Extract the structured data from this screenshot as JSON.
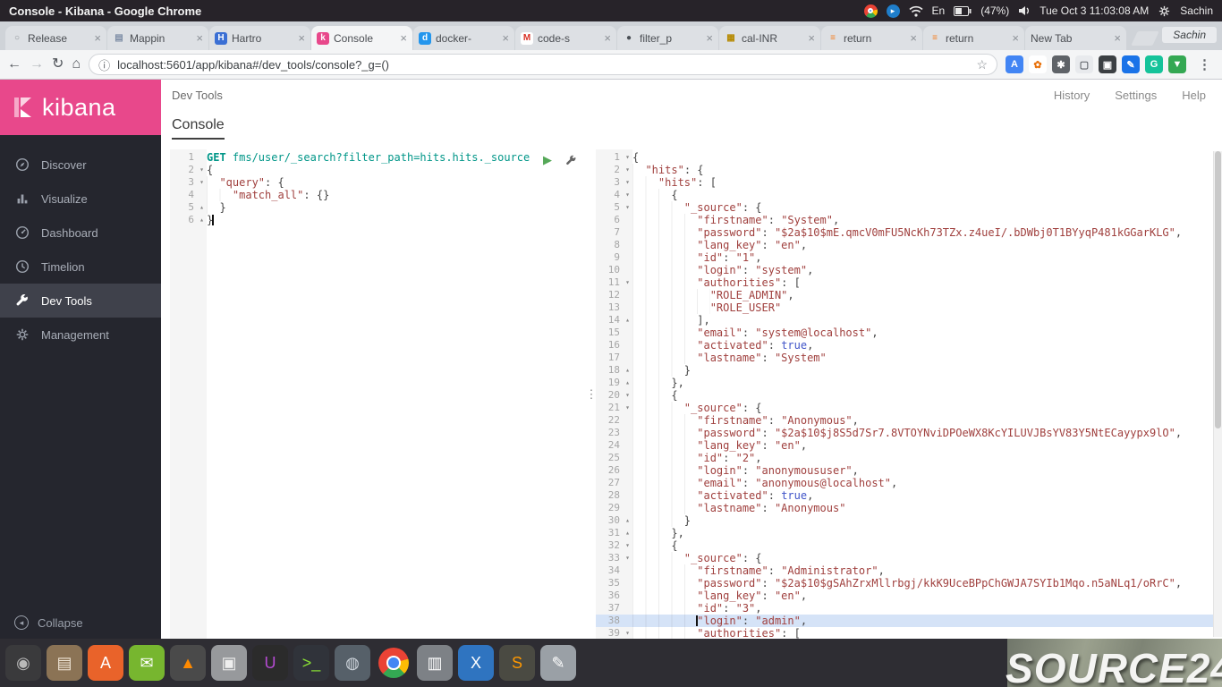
{
  "system_bar": {
    "window_title": "Console - Kibana - Google Chrome",
    "tray": [
      {
        "kind": "icon",
        "name": "chrome-icon"
      },
      {
        "kind": "icon",
        "name": "software-updater-icon"
      },
      {
        "kind": "icon",
        "name": "wifi-icon"
      },
      {
        "kind": "text",
        "name": "keyboard-indicator",
        "text": "En"
      },
      {
        "kind": "icon",
        "name": "battery-icon"
      },
      {
        "kind": "text",
        "name": "battery-percentage",
        "text": "(47%)"
      },
      {
        "kind": "icon",
        "name": "volume-icon"
      },
      {
        "kind": "text",
        "name": "clock",
        "text": "Tue Oct 3 11:03:08 AM"
      },
      {
        "kind": "icon",
        "name": "session-gear-icon"
      },
      {
        "kind": "text",
        "name": "session-user",
        "text": "Sachin"
      }
    ]
  },
  "browser": {
    "profile": "Sachin",
    "url": "localhost:5601/app/kibana#/dev_tools/console?_g=()",
    "tabs": [
      {
        "label": "Release",
        "icon": "release-circle-icon",
        "active": false
      },
      {
        "label": "Mappin",
        "icon": "list-icon",
        "active": false
      },
      {
        "label": "Hartro",
        "icon": "h-doc-icon",
        "active": false
      },
      {
        "label": "Console",
        "icon": "kibana-icon",
        "active": true
      },
      {
        "label": "docker-",
        "icon": "docker-icon",
        "active": false
      },
      {
        "label": "code-s",
        "icon": "gmail-icon",
        "active": false
      },
      {
        "label": "filter_p",
        "icon": "page-circle-icon",
        "active": false
      },
      {
        "label": "cal-INR",
        "icon": "calculator-icon",
        "active": false
      },
      {
        "label": "return",
        "icon": "stackoverflow-icon",
        "active": false
      },
      {
        "label": "return",
        "icon": "stackoverflow-icon",
        "active": false
      },
      {
        "label": "New Tab",
        "icon": "",
        "active": false
      }
    ],
    "extensions": [
      {
        "name": "translate-icon",
        "glyph": "A",
        "bg": "#4285f4",
        "fg": "#ffffff"
      },
      {
        "name": "pinwheel-icon",
        "glyph": "✿",
        "bg": "#ffffff",
        "fg": "#e8710a"
      },
      {
        "name": "gear-extension-icon",
        "glyph": "✱",
        "bg": "#5f6368",
        "fg": "#ffffff"
      },
      {
        "name": "window-extension-icon",
        "glyph": "▢",
        "bg": "#e8eaed",
        "fg": "#5f6368"
      },
      {
        "name": "tag-extension-icon",
        "glyph": "▣",
        "bg": "#3c4043",
        "fg": "#ffffff"
      },
      {
        "name": "pen-extension-icon",
        "glyph": "✎",
        "bg": "#1a73e8",
        "fg": "#ffffff"
      },
      {
        "name": "grammarly-icon",
        "glyph": "G",
        "bg": "#15c39a",
        "fg": "#ffffff"
      },
      {
        "name": "download-extension-icon",
        "glyph": "▼",
        "bg": "#34a853",
        "fg": "#ffffff"
      }
    ]
  },
  "kibana": {
    "logo_text": "kibana",
    "breadcrumb": "Dev Tools",
    "top_links": [
      "History",
      "Settings",
      "Help"
    ],
    "console_tab": "Console",
    "collapse_label": "Collapse",
    "nav": [
      {
        "label": "Discover",
        "icon": "discover-icon",
        "active": false
      },
      {
        "label": "Visualize",
        "icon": "visualize-icon",
        "active": false
      },
      {
        "label": "Dashboard",
        "icon": "dashboard-icon",
        "active": false
      },
      {
        "label": "Timelion",
        "icon": "timelion-icon",
        "active": false
      },
      {
        "label": "Dev Tools",
        "icon": "wrench-icon",
        "active": true
      },
      {
        "label": "Management",
        "icon": "gear-icon",
        "active": false
      }
    ]
  },
  "colors": {
    "kibana_pink": "#e8488b",
    "method_teal": "#009688",
    "string_red": "#a0403e",
    "boolean_blue": "#4054c8",
    "play_green": "#55a858",
    "active_line": "#d5e3f7"
  },
  "request_editor": {
    "lines": [
      {
        "n": 1,
        "f": "",
        "seg": [
          [
            "m",
            "GET "
          ],
          [
            "u",
            "fms/user/_search?filter_path=hits.hits._source"
          ]
        ]
      },
      {
        "n": 2,
        "f": "d",
        "seg": [
          [
            "p",
            "{"
          ]
        ]
      },
      {
        "n": 3,
        "f": "d",
        "seg": [
          [
            "ws",
            "  "
          ],
          [
            "k",
            "\"query\""
          ],
          [
            "p",
            ": {"
          ]
        ]
      },
      {
        "n": 4,
        "f": "",
        "seg": [
          [
            "ws",
            "    "
          ],
          [
            "k",
            "\"match_all\""
          ],
          [
            "p",
            ": {}"
          ]
        ]
      },
      {
        "n": 5,
        "f": "u",
        "seg": [
          [
            "ws",
            "  "
          ],
          [
            "p",
            "}"
          ]
        ]
      },
      {
        "n": 6,
        "f": "u",
        "seg": [
          [
            "p",
            "}"
          ],
          [
            "caret",
            ""
          ]
        ]
      }
    ]
  },
  "response_editor": {
    "lines": [
      {
        "n": 1,
        "f": "d",
        "seg": [
          [
            "p",
            "{"
          ]
        ]
      },
      {
        "n": 2,
        "f": "d",
        "seg": [
          [
            "ws",
            "  "
          ],
          [
            "k",
            "\"hits\""
          ],
          [
            "p",
            ": {"
          ]
        ]
      },
      {
        "n": 3,
        "f": "d",
        "seg": [
          [
            "ws",
            "    "
          ],
          [
            "k",
            "\"hits\""
          ],
          [
            "p",
            ": ["
          ]
        ]
      },
      {
        "n": 4,
        "f": "d",
        "seg": [
          [
            "ws",
            "      "
          ],
          [
            "p",
            "{"
          ]
        ]
      },
      {
        "n": 5,
        "f": "d",
        "seg": [
          [
            "ws",
            "        "
          ],
          [
            "k",
            "\"_source\""
          ],
          [
            "p",
            ": {"
          ]
        ]
      },
      {
        "n": 6,
        "f": "",
        "seg": [
          [
            "ws",
            "          "
          ],
          [
            "k",
            "\"firstname\""
          ],
          [
            "p",
            ": "
          ],
          [
            "s",
            "\"System\""
          ],
          [
            "p",
            ","
          ]
        ]
      },
      {
        "n": 7,
        "f": "",
        "seg": [
          [
            "ws",
            "          "
          ],
          [
            "k",
            "\"password\""
          ],
          [
            "p",
            ": "
          ],
          [
            "s",
            "\"$2a$10$mE.qmcV0mFU5NcKh73TZx.z4ueI/.bDWbj0T1BYyqP481kGGarKLG\""
          ],
          [
            "p",
            ","
          ]
        ]
      },
      {
        "n": 8,
        "f": "",
        "seg": [
          [
            "ws",
            "          "
          ],
          [
            "k",
            "\"lang_key\""
          ],
          [
            "p",
            ": "
          ],
          [
            "s",
            "\"en\""
          ],
          [
            "p",
            ","
          ]
        ]
      },
      {
        "n": 9,
        "f": "",
        "seg": [
          [
            "ws",
            "          "
          ],
          [
            "k",
            "\"id\""
          ],
          [
            "p",
            ": "
          ],
          [
            "s",
            "\"1\""
          ],
          [
            "p",
            ","
          ]
        ]
      },
      {
        "n": 10,
        "f": "",
        "seg": [
          [
            "ws",
            "          "
          ],
          [
            "k",
            "\"login\""
          ],
          [
            "p",
            ": "
          ],
          [
            "s",
            "\"system\""
          ],
          [
            "p",
            ","
          ]
        ]
      },
      {
        "n": 11,
        "f": "d",
        "seg": [
          [
            "ws",
            "          "
          ],
          [
            "k",
            "\"authorities\""
          ],
          [
            "p",
            ": ["
          ]
        ]
      },
      {
        "n": 12,
        "f": "",
        "seg": [
          [
            "ws",
            "            "
          ],
          [
            "s",
            "\"ROLE_ADMIN\""
          ],
          [
            "p",
            ","
          ]
        ]
      },
      {
        "n": 13,
        "f": "",
        "seg": [
          [
            "ws",
            "            "
          ],
          [
            "s",
            "\"ROLE_USER\""
          ]
        ]
      },
      {
        "n": 14,
        "f": "u",
        "seg": [
          [
            "ws",
            "          "
          ],
          [
            "p",
            "],"
          ]
        ]
      },
      {
        "n": 15,
        "f": "",
        "seg": [
          [
            "ws",
            "          "
          ],
          [
            "k",
            "\"email\""
          ],
          [
            "p",
            ": "
          ],
          [
            "s",
            "\"system@localhost\""
          ],
          [
            "p",
            ","
          ]
        ]
      },
      {
        "n": 16,
        "f": "",
        "seg": [
          [
            "ws",
            "          "
          ],
          [
            "k",
            "\"activated\""
          ],
          [
            "p",
            ": "
          ],
          [
            "b",
            "true"
          ],
          [
            "p",
            ","
          ]
        ]
      },
      {
        "n": 17,
        "f": "",
        "seg": [
          [
            "ws",
            "          "
          ],
          [
            "k",
            "\"lastname\""
          ],
          [
            "p",
            ": "
          ],
          [
            "s",
            "\"System\""
          ]
        ]
      },
      {
        "n": 18,
        "f": "u",
        "seg": [
          [
            "ws",
            "        "
          ],
          [
            "p",
            "}"
          ]
        ]
      },
      {
        "n": 19,
        "f": "u",
        "seg": [
          [
            "ws",
            "      "
          ],
          [
            "p",
            "},"
          ]
        ]
      },
      {
        "n": 20,
        "f": "d",
        "seg": [
          [
            "ws",
            "      "
          ],
          [
            "p",
            "{"
          ]
        ]
      },
      {
        "n": 21,
        "f": "d",
        "seg": [
          [
            "ws",
            "        "
          ],
          [
            "k",
            "\"_source\""
          ],
          [
            "p",
            ": {"
          ]
        ]
      },
      {
        "n": 22,
        "f": "",
        "seg": [
          [
            "ws",
            "          "
          ],
          [
            "k",
            "\"firstname\""
          ],
          [
            "p",
            ": "
          ],
          [
            "s",
            "\"Anonymous\""
          ],
          [
            "p",
            ","
          ]
        ]
      },
      {
        "n": 23,
        "f": "",
        "seg": [
          [
            "ws",
            "          "
          ],
          [
            "k",
            "\"password\""
          ],
          [
            "p",
            ": "
          ],
          [
            "s",
            "\"$2a$10$j8S5d7Sr7.8VTOYNviDPOeWX8KcYILUVJBsYV83Y5NtECayypx9lO\""
          ],
          [
            "p",
            ","
          ]
        ]
      },
      {
        "n": 24,
        "f": "",
        "seg": [
          [
            "ws",
            "          "
          ],
          [
            "k",
            "\"lang_key\""
          ],
          [
            "p",
            ": "
          ],
          [
            "s",
            "\"en\""
          ],
          [
            "p",
            ","
          ]
        ]
      },
      {
        "n": 25,
        "f": "",
        "seg": [
          [
            "ws",
            "          "
          ],
          [
            "k",
            "\"id\""
          ],
          [
            "p",
            ": "
          ],
          [
            "s",
            "\"2\""
          ],
          [
            "p",
            ","
          ]
        ]
      },
      {
        "n": 26,
        "f": "",
        "seg": [
          [
            "ws",
            "          "
          ],
          [
            "k",
            "\"login\""
          ],
          [
            "p",
            ": "
          ],
          [
            "s",
            "\"anonymoususer\""
          ],
          [
            "p",
            ","
          ]
        ]
      },
      {
        "n": 27,
        "f": "",
        "seg": [
          [
            "ws",
            "          "
          ],
          [
            "k",
            "\"email\""
          ],
          [
            "p",
            ": "
          ],
          [
            "s",
            "\"anonymous@localhost\""
          ],
          [
            "p",
            ","
          ]
        ]
      },
      {
        "n": 28,
        "f": "",
        "seg": [
          [
            "ws",
            "          "
          ],
          [
            "k",
            "\"activated\""
          ],
          [
            "p",
            ": "
          ],
          [
            "b",
            "true"
          ],
          [
            "p",
            ","
          ]
        ]
      },
      {
        "n": 29,
        "f": "",
        "seg": [
          [
            "ws",
            "          "
          ],
          [
            "k",
            "\"lastname\""
          ],
          [
            "p",
            ": "
          ],
          [
            "s",
            "\"Anonymous\""
          ]
        ]
      },
      {
        "n": 30,
        "f": "u",
        "seg": [
          [
            "ws",
            "        "
          ],
          [
            "p",
            "}"
          ]
        ]
      },
      {
        "n": 31,
        "f": "u",
        "seg": [
          [
            "ws",
            "      "
          ],
          [
            "p",
            "},"
          ]
        ]
      },
      {
        "n": 32,
        "f": "d",
        "seg": [
          [
            "ws",
            "      "
          ],
          [
            "p",
            "{"
          ]
        ]
      },
      {
        "n": 33,
        "f": "d",
        "seg": [
          [
            "ws",
            "        "
          ],
          [
            "k",
            "\"_source\""
          ],
          [
            "p",
            ": {"
          ]
        ]
      },
      {
        "n": 34,
        "f": "",
        "seg": [
          [
            "ws",
            "          "
          ],
          [
            "k",
            "\"firstname\""
          ],
          [
            "p",
            ": "
          ],
          [
            "s",
            "\"Administrator\""
          ],
          [
            "p",
            ","
          ]
        ]
      },
      {
        "n": 35,
        "f": "",
        "seg": [
          [
            "ws",
            "          "
          ],
          [
            "k",
            "\"password\""
          ],
          [
            "p",
            ": "
          ],
          [
            "s",
            "\"$2a$10$gSAhZrxMllrbgj/kkK9UceBPpChGWJA7SYIb1Mqo.n5aNLq1/oRrC\""
          ],
          [
            "p",
            ","
          ]
        ]
      },
      {
        "n": 36,
        "f": "",
        "seg": [
          [
            "ws",
            "          "
          ],
          [
            "k",
            "\"lang_key\""
          ],
          [
            "p",
            ": "
          ],
          [
            "s",
            "\"en\""
          ],
          [
            "p",
            ","
          ]
        ]
      },
      {
        "n": 37,
        "f": "",
        "seg": [
          [
            "ws",
            "          "
          ],
          [
            "k",
            "\"id\""
          ],
          [
            "p",
            ": "
          ],
          [
            "s",
            "\"3\""
          ],
          [
            "p",
            ","
          ]
        ]
      },
      {
        "n": 38,
        "f": "",
        "hl": true,
        "seg": [
          [
            "ws",
            "          "
          ],
          [
            "caret",
            ""
          ],
          [
            "k",
            "\"login\""
          ],
          [
            "p",
            ": "
          ],
          [
            "s",
            "\"admin\""
          ],
          [
            "p",
            ","
          ]
        ]
      },
      {
        "n": 39,
        "f": "d",
        "seg": [
          [
            "ws",
            "          "
          ],
          [
            "k",
            "\"authorities\""
          ],
          [
            "p",
            ": ["
          ]
        ]
      }
    ]
  },
  "dock": {
    "watermark": "SOURCE24",
    "items": [
      {
        "name": "dash-home-icon",
        "glyph": "◉",
        "bg": "#3a3a3c",
        "fg": "#b9b9b9"
      },
      {
        "name": "files-icon",
        "glyph": "▤",
        "bg": "#8b7355",
        "fg": "#f0e6d6"
      },
      {
        "name": "software-center-icon",
        "glyph": "A",
        "bg": "#e9632a",
        "fg": "#ffffff"
      },
      {
        "name": "messaging-icon",
        "glyph": "✉",
        "bg": "#77b62f",
        "fg": "#ffffff"
      },
      {
        "name": "vlc-icon",
        "glyph": "▲",
        "bg": "#4a4a4a",
        "fg": "#ff8a00"
      },
      {
        "name": "package-icon",
        "glyph": "▣",
        "bg": "#97999c",
        "fg": "#eeeeee"
      },
      {
        "name": "intellij-icon",
        "glyph": "U",
        "bg": "#2b2b2b",
        "fg": "#b44bd2"
      },
      {
        "name": "terminal-icon",
        "glyph": ">_",
        "bg": "#30333a",
        "fg": "#8ae234"
      },
      {
        "name": "workspace-icon",
        "glyph": "◍",
        "bg": "#566069",
        "fg": "#cfd6dd"
      },
      {
        "name": "chrome-icon",
        "glyph": "",
        "bg": "",
        "fg": ""
      },
      {
        "name": "printer-icon",
        "glyph": "▥",
        "bg": "#7d8186",
        "fg": "#ffffff"
      },
      {
        "name": "draw-icon",
        "glyph": "X",
        "bg": "#2f74c0",
        "fg": "#ffffff"
      },
      {
        "name": "sublime-icon",
        "glyph": "S",
        "bg": "#4a4a42",
        "fg": "#ff9800"
      },
      {
        "name": "editor-icon",
        "glyph": "✎",
        "bg": "#9aa0a6",
        "fg": "#ffffff"
      }
    ]
  }
}
